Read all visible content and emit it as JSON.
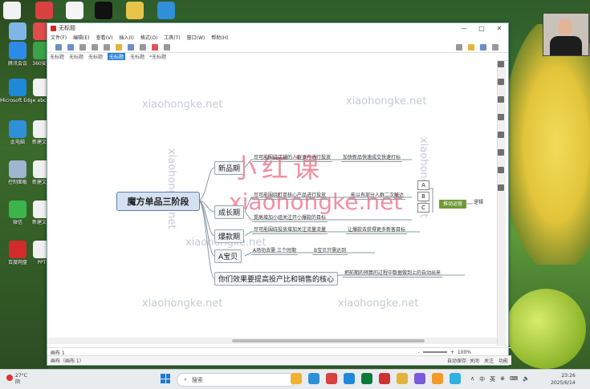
{
  "desktop": {
    "icons": [
      {
        "label": "回收站",
        "color": "#7fb6e6"
      },
      {
        "label": "",
        "color": "#e04c4c"
      },
      {
        "label": "腾讯会议",
        "color": "#2c8be8"
      },
      {
        "label": "360安全",
        "color": "#3aa24a"
      },
      {
        "label": "Microsoft Edge",
        "color": "#1e88d9"
      },
      {
        "label": "ebc",
        "color": "#f2f2f2"
      },
      {
        "label": "此电脑",
        "color": "#2f8fd8"
      },
      {
        "label": "新建文件",
        "color": "#f0f0f0"
      },
      {
        "label": "控制面板",
        "color": "#9fb4cf"
      },
      {
        "label": "新建文件",
        "color": "#f0f0f0"
      },
      {
        "label": "微信",
        "color": "#3bb54a"
      },
      {
        "label": "新建文本",
        "color": "#f0f0f0"
      },
      {
        "label": "百度网盘",
        "color": "#d22b2b"
      },
      {
        "label": "PPT",
        "color": "#f0f0f0"
      }
    ],
    "top_icons": [
      {
        "color": "#f2f2f2"
      },
      {
        "color": "#d94040"
      },
      {
        "color": "#f5f5f5"
      },
      {
        "color": "#111111"
      },
      {
        "color": "#e8c34a"
      },
      {
        "color": "#2f8fd8"
      }
    ]
  },
  "window": {
    "title": "无标题",
    "menu": [
      "文件(F)",
      "编辑(E)",
      "查看(V)",
      "插入(I)",
      "格式(O)",
      "工具(T)",
      "窗口(W)",
      "帮助(H)"
    ],
    "tabs": [
      "无标题",
      "无标题",
      "无标题",
      "无标题",
      "无标题",
      "*无标题"
    ],
    "active_tab_index": 3,
    "controls": [
      "—",
      "□",
      "✕"
    ]
  },
  "watermark": {
    "text": "xiaohongke.net",
    "big1": "小红课",
    "big2": "xiaohongke.net"
  },
  "mindmap": {
    "root": "魔方单品三阶段",
    "branches": [
      {
        "label": "新品期",
        "leaves": [
          "尽可能围绕店铺的人群资产进行投放",
          "加快新品快速成交快速打标"
        ]
      },
      {
        "label": "成长期",
        "leaves": [
          "尽可能围绕打单核心产品进行投放",
          "能以有部分人群二次触达",
          "提高增加小组关注开小爆款的目标"
        ]
      },
      {
        "label": "爆款期",
        "leaves": [
          "尽可能围绕投放增加关注流量流量",
          "让爆款去获得更多新客目标"
        ]
      },
      {
        "label": "A宝贝",
        "leaves": [
          "A场功去需 三个时期",
          "B宝贝只需达到"
        ]
      },
      {
        "label": "你们效果要提高投产比和销售的核心",
        "leaves": [
          "把前期的预算的过程中数据做到上的自动出来"
        ]
      }
    ],
    "tags": [
      "A",
      "B",
      "C"
    ],
    "green_node": "推动运营",
    "far_leaf": "逻辑"
  },
  "status": {
    "page": "画布 1",
    "sheet": "画布（画布 1）",
    "zoom": "100%",
    "zoom_minus": "-",
    "zoom_plus": "+",
    "right_labels": [
      "自动保存: 关闭",
      "关注",
      "功能"
    ]
  },
  "taskbar": {
    "weather_temp": "27°C",
    "weather_desc": "阴",
    "search_placeholder": "搜索",
    "apps": [
      "#f0b030",
      "#2f8fd8",
      "#d94040",
      "#1e88d9",
      "#0d7a3a",
      "#c33",
      "#e2b23a",
      "#7a5ad8",
      "#f29a2b",
      "#2fb0e0"
    ],
    "tray": [
      "∧",
      "中",
      "英",
      "⊗",
      "⌨",
      "🔈",
      "🔋"
    ],
    "time": "23:26",
    "date": "2025/6/14"
  }
}
